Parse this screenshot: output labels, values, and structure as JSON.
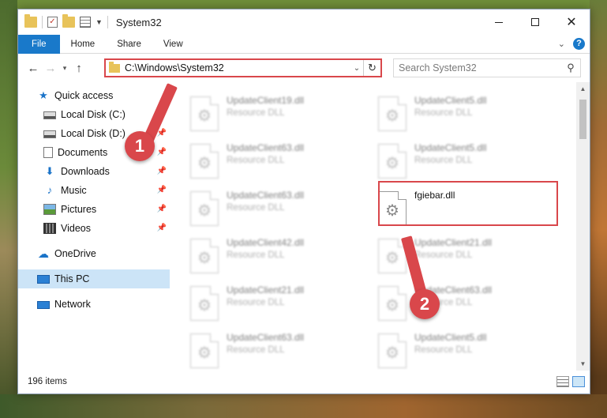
{
  "window": {
    "title": "System32"
  },
  "ribbon": {
    "tabs": [
      "File",
      "Home",
      "Share",
      "View"
    ]
  },
  "address": {
    "path": "C:\\Windows\\System32"
  },
  "search": {
    "placeholder": "Search System32"
  },
  "sidebar": {
    "items": [
      {
        "label": "Quick access",
        "icon": "star-icon",
        "pinned": false
      },
      {
        "label": "Local Disk (C:)",
        "icon": "drive-icon",
        "pinned": true
      },
      {
        "label": "Local Disk (D:)",
        "icon": "drive-icon",
        "pinned": true
      },
      {
        "label": "Documents",
        "icon": "documents-icon",
        "pinned": true
      },
      {
        "label": "Downloads",
        "icon": "download-icon",
        "pinned": true
      },
      {
        "label": "Music",
        "icon": "music-icon",
        "pinned": true
      },
      {
        "label": "Pictures",
        "icon": "pictures-icon",
        "pinned": true
      },
      {
        "label": "Videos",
        "icon": "videos-icon",
        "pinned": true
      },
      {
        "label": "OneDrive",
        "icon": "onedrive-icon",
        "pinned": false
      },
      {
        "label": "This PC",
        "icon": "this-pc-icon",
        "pinned": false,
        "selected": true
      },
      {
        "label": "Network",
        "icon": "network-icon",
        "pinned": false
      }
    ]
  },
  "files": [
    {
      "name": "UpdateClient19.dll",
      "type": "Resource DLL"
    },
    {
      "name": "UpdateClient5.dll",
      "type": "Resource DLL"
    },
    {
      "name": "UpdateClient63.dll",
      "type": "Resource DLL"
    },
    {
      "name": "UpdateClient5.dll",
      "type": "Resource DLL"
    },
    {
      "name": "UpdateClient63.dll",
      "type": "Resource DLL"
    },
    {
      "name": "fgiebar.dll",
      "type": "",
      "highlighted": true
    },
    {
      "name": "UpdateClient42.dll",
      "type": "Resource DLL"
    },
    {
      "name": "UpdateClient21.dll",
      "type": "Resource DLL"
    },
    {
      "name": "UpdateClient21.dll",
      "type": "Resource DLL"
    },
    {
      "name": "UpdateClient63.dll",
      "type": "Resource DLL"
    },
    {
      "name": "UpdateClient63.dll",
      "type": "Resource DLL"
    },
    {
      "name": "UpdateClient5.dll",
      "type": "Resource DLL"
    }
  ],
  "status": {
    "item_count": "196 items"
  },
  "callouts": {
    "one": "1",
    "two": "2"
  },
  "colors": {
    "accent": "#1979ca",
    "callout": "#d9474b",
    "selected": "#cce4f7"
  }
}
